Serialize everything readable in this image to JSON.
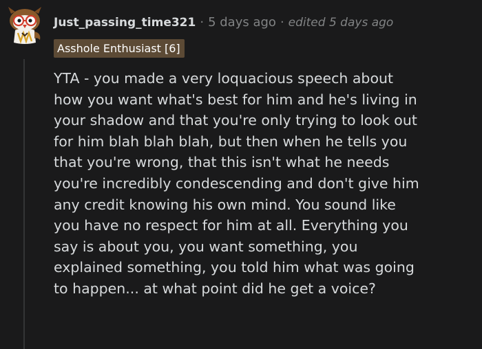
{
  "comment": {
    "author": "Just_passing_time321",
    "separator": "·",
    "posted": "5 days ago",
    "edited": "edited 5 days ago",
    "flair": "Asshole Enthusiast [6]",
    "body_lines": [
      "YTA - you made a very loquacious speech about",
      "how you want what's best for him and he's living in",
      "your shadow and that you're only trying to look out",
      "for him blah blah blah, but then when he tells you",
      "that you're wrong, that this isn't what he needs",
      "you're incredibly condescending and don't give him",
      "any credit knowing his own mind. You sound like",
      "you have no respect for him at all. Everything you",
      "say is about you, you want something, you",
      "explained something, you told him what was going",
      "to happen... at what point did he get a voice?"
    ],
    "avatar_icon": "owl-avatar-icon",
    "colors": {
      "background": "#1a1a1b",
      "text": "#d7dadc",
      "muted": "#818384",
      "flair_bg": "#5c4a35",
      "thread_line": "#343536"
    }
  }
}
